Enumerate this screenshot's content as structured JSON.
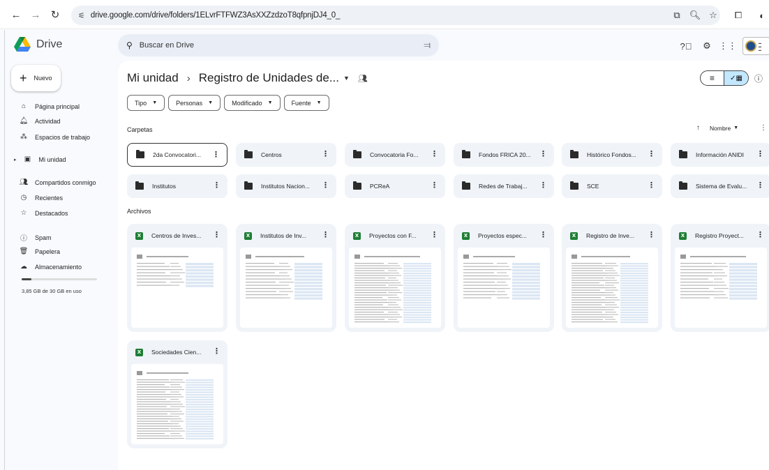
{
  "browser": {
    "url": "drive.google.com/drive/folders/1ELvrFTFWZ3AsXXZzdzoT8qfpnjDJ4_0_"
  },
  "header": {
    "app_name": "Drive",
    "search_placeholder": "Buscar en Drive"
  },
  "sidebar": {
    "new_label": "Nuevo",
    "items": [
      {
        "label": "Página principal",
        "icon": "home-icon"
      },
      {
        "label": "Actividad",
        "icon": "bell-icon"
      },
      {
        "label": "Espacios de trabajo",
        "icon": "workspaces-icon"
      },
      {
        "label": "Mi unidad",
        "icon": "drive-icon"
      },
      {
        "label": "Compartidos conmigo",
        "icon": "people-icon"
      },
      {
        "label": "Recientes",
        "icon": "clock-icon"
      },
      {
        "label": "Destacados",
        "icon": "star-icon"
      },
      {
        "label": "Spam",
        "icon": "spam-icon"
      },
      {
        "label": "Papelera",
        "icon": "trash-icon"
      },
      {
        "label": "Almacenamiento",
        "icon": "cloud-icon"
      }
    ],
    "storage_text": "3,85 GB de 30 GB en uso",
    "storage_fraction": 0.13
  },
  "breadcrumb": {
    "root": "Mi unidad",
    "current": "Registro de Unidades de..."
  },
  "filters": [
    "Tipo",
    "Personas",
    "Modificado",
    "Fuente"
  ],
  "sort_label": "Nombre",
  "sections": {
    "folders": "Carpetas",
    "files": "Archivos"
  },
  "folders": [
    "2da Convocatori...",
    "Centros",
    "Convocatoria Fo...",
    "Fondos FRICA 20...",
    "Histórico Fondos...",
    "Información ANIDI",
    "Institutos",
    "Institutos Nacion...",
    "PCReA",
    "Redes de Trabaj...",
    "SCE",
    "Sistema de Evalu..."
  ],
  "files": [
    "Centros de Inves...",
    "Institutos de Inv...",
    "Proyectos con F...",
    "Proyectos espec...",
    "Registro de Inve...",
    "Registro Proyect...",
    "Sociedades Cien..."
  ]
}
